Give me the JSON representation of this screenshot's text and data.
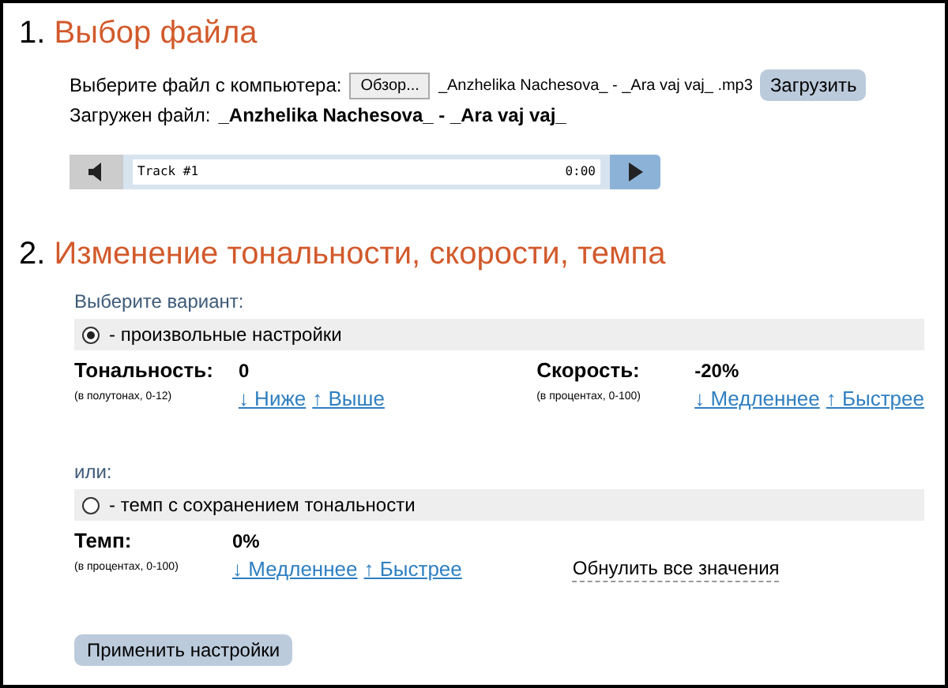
{
  "section1": {
    "number": "1.",
    "title": "Выбор файла",
    "file_label": "Выберите файл с компьютера:",
    "browse_button": "Обзор...",
    "file_name": "_Anzhelika Nachesova_ - _Ara vaj vaj_ .mp3",
    "upload_button": "Загрузить",
    "loaded_label": "Загружен файл:",
    "loaded_name": "_Anzhelika Nachesova_ - _Ara vaj vaj_",
    "player": {
      "track": "Track #1",
      "time": "0:00"
    }
  },
  "section2": {
    "number": "2.",
    "title": "Изменение тональности, скорости, темпа",
    "prompt": "Выберите вариант:",
    "options": [
      {
        "label": "- произвольные настройки",
        "selected": true,
        "params": [
          {
            "name": "Тональность:",
            "hint": "(в полутонах, 0-12)",
            "value": "0",
            "links": [
              "↓ Ниже",
              "↑ Выше"
            ]
          },
          {
            "name": "Скорость:",
            "hint": "(в процентах, 0-100)",
            "value": "-20%",
            "links": [
              "↓ Медленнее",
              "↑ Быстрее"
            ]
          }
        ]
      },
      {
        "label": "- темп с сохранением тональности",
        "selected": false,
        "params": [
          {
            "name": "Темп:",
            "hint": "(в процентах, 0-100)",
            "value": "0%",
            "links": [
              "↓ Медленнее",
              "↑ Быстрее"
            ]
          }
        ]
      }
    ],
    "or_label": "или:",
    "reset_link": "Обнулить все значения",
    "apply_button": "Применить настройки"
  }
}
